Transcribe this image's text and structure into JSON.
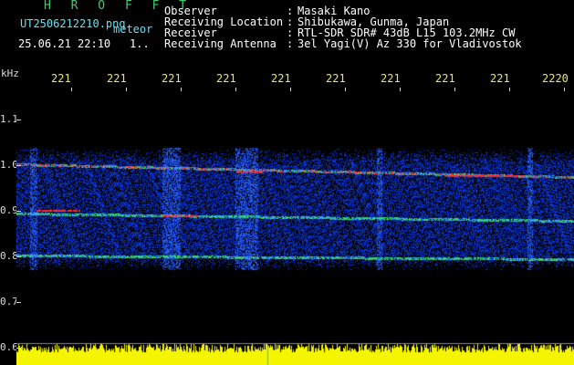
{
  "header": {
    "station": "H R O F F T",
    "filename": "UT2506212210.png",
    "meteor_word": "meteor",
    "datetime": "25.06.21 22:10",
    "small_counter": "1..",
    "fields": [
      {
        "label": "Observer",
        "value": "Masaki Kano"
      },
      {
        "label": "Receiving Location",
        "value": "Shibukawa, Gunma, Japan"
      },
      {
        "label": "Receiver",
        "value": "RTL-SDR SDR# 43dB L15 103.2MHz CW"
      },
      {
        "label": "Receiving Antenna",
        "value": "3el Yagi(V) Az 330 for Vladivostok"
      }
    ]
  },
  "spectrogram": {
    "y_unit": "kHz",
    "y_ticks": [
      "1.1",
      "1.0",
      "0.9",
      "0.8",
      "0.7",
      "0.6"
    ],
    "x_ticks": [
      "221",
      "221",
      "221",
      "221",
      "221",
      "221",
      "221",
      "221",
      "221",
      "2220"
    ],
    "colors": {
      "background": "#000000",
      "noise": "#0a3bd8",
      "strong": "#ff2a2a",
      "medium": "#2ad44a",
      "amplitude_bar": "#f5f500"
    }
  }
}
